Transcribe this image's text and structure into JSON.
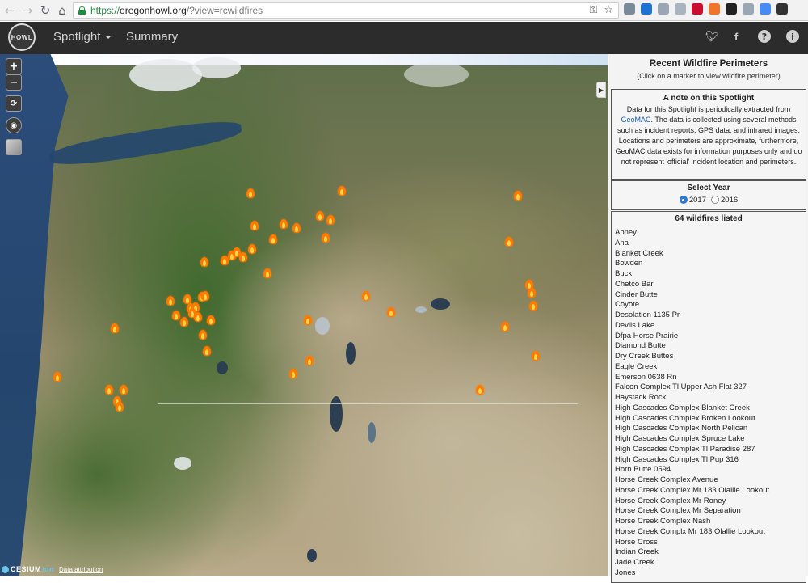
{
  "browser": {
    "url_scheme": "https://",
    "url_host": "oregonhowl.org",
    "url_path": "/?view=rcwildfires",
    "back_icon": "arrow-left-icon",
    "forward_icon": "arrow-right-icon",
    "reload_icon": "reload-icon",
    "home_icon": "home-icon",
    "key_icon": "key-icon",
    "star_icon": "star-icon",
    "extension_colors": [
      "#7a8a9a",
      "#1f74d3",
      "#9aa6b3",
      "#aab4c0",
      "#c8102e",
      "#f0742a",
      "#222222",
      "#9aa6b3",
      "#4a8af4",
      "#333333"
    ]
  },
  "header": {
    "logo_text": "HOWL",
    "menu_spotlight": "Spotlight",
    "menu_summary": "Summary",
    "twitter_icon": "twitter-icon",
    "facebook_icon": "facebook-icon",
    "help_icon": "help-icon",
    "info_icon": "info-icon"
  },
  "map": {
    "zoom_in": "+",
    "zoom_out": "−",
    "reset_icon": "reset-icon",
    "compass_icon": "compass-icon",
    "layers_icon": "layers-icon",
    "cesium_label": "CESIUM",
    "cesium_ion": "ion",
    "attribution_link": "Data attribution",
    "fire_marker_icon": "fire-marker-icon"
  },
  "panel": {
    "toggle_icon": "chevron-right-icon",
    "title": "Recent Wildfire Perimeters",
    "subtitle": "(Click on a marker to view wildfire perimeter)",
    "note_heading": "A note on this Spotlight",
    "note_before_link": "Data for this Spotlight is periodically extracted from",
    "note_link": "GeoMAC",
    "note_after_link": ". The data is collected using several methods such as incident reports, GPS data, and infrared images. Locations and perimeters are approximate, furthermore, GeoMAC data exists for information purposes only and do not represent 'official' incident location and perimeters.",
    "year_heading": "Select Year",
    "year_options": [
      "2017",
      "2016"
    ],
    "selected_year": "2017",
    "count_label": "64 wildfires listed",
    "wildfires": [
      "Abney",
      "Ana",
      "Blanket Creek",
      "Bowden",
      "Buck",
      "Chetco Bar",
      "Cinder Butte",
      "Coyote",
      "Desolation 1135 Pr",
      "Devils Lake",
      "Dfpa Horse Prairie",
      "Diamond Butte",
      "Dry Creek Buttes",
      "Eagle Creek",
      "Emerson 0638 Rn",
      "Falcon Complex Tl Upper Ash Flat 327",
      "Haystack Rock",
      "High Cascades Complex Blanket Creek",
      "High Cascades Complex Broken Lookout",
      "High Cascades Complex North Pelican",
      "High Cascades Complex Spruce Lake",
      "High Cascades Complex Tl Paradise 287",
      "High Cascades Complex Tl Pup 316",
      "Horn Butte 0594",
      "Horse Creek Complex Avenue",
      "Horse Creek Complex Mr 183 Olallie Lookout",
      "Horse Creek Complex Mr Roney",
      "Horse Creek Complex Mr Separation",
      "Horse Creek Complex Nash",
      "Horse Creek Complx Mr 183 Olallie Lookout",
      "Horse Cross",
      "Indian Creek",
      "Jade Creek",
      "Jones"
    ]
  }
}
